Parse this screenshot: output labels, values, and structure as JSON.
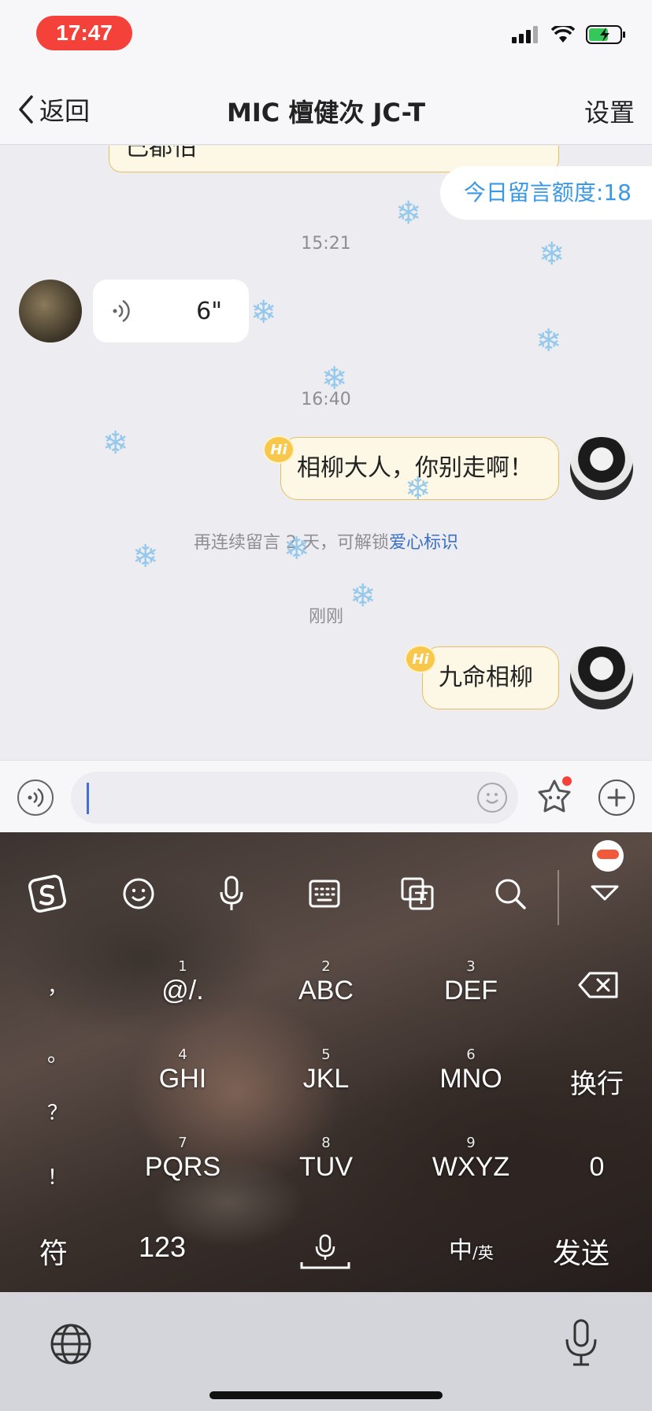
{
  "status_bar": {
    "time": "17:47"
  },
  "nav": {
    "back_label": "返回",
    "title": "MIC 檀健次 JC-T",
    "settings_label": "设置"
  },
  "chat": {
    "partial_message": "己都怕",
    "quota_label": "今日留言额度:18",
    "timestamps": [
      "15:21",
      "16:40",
      "刚刚"
    ],
    "voice_message": {
      "duration": "6\""
    },
    "messages": [
      {
        "badge": "Hi",
        "text": "相柳大人，你别走啊！"
      },
      {
        "badge": "Hi",
        "text": "九命相柳"
      }
    ],
    "notice": {
      "text": "再连续留言 2 天，可解锁",
      "link": "爱心标识"
    }
  },
  "input_bar": {
    "value": "",
    "placeholder": ""
  },
  "keyboard": {
    "toolbar_icons": [
      "sogou-logo-icon",
      "emoji-icon",
      "microphone-icon",
      "keyboard-icon",
      "translate-icon",
      "search-icon",
      "collapse-icon"
    ],
    "side_symbols": [
      "，",
      "。",
      "？",
      "！"
    ],
    "keys": [
      {
        "num": "1",
        "label": "@/."
      },
      {
        "num": "2",
        "label": "ABC"
      },
      {
        "num": "3",
        "label": "DEF"
      },
      {
        "num": "4",
        "label": "GHI"
      },
      {
        "num": "5",
        "label": "JKL"
      },
      {
        "num": "6",
        "label": "MNO"
      },
      {
        "num": "7",
        "label": "PQRS"
      },
      {
        "num": "8",
        "label": "TUV"
      },
      {
        "num": "9",
        "label": "WXYZ"
      }
    ],
    "newline_label": "换行",
    "zero_label": "0",
    "symbols_label": "符",
    "numbers_label": "123",
    "lang_label": "中",
    "lang_sub": "/英",
    "send_label": "发送"
  },
  "colors": {
    "accent_blue": "#3a98e4",
    "bubble_border": "#e5bf62",
    "time_pill": "#f4423b"
  }
}
